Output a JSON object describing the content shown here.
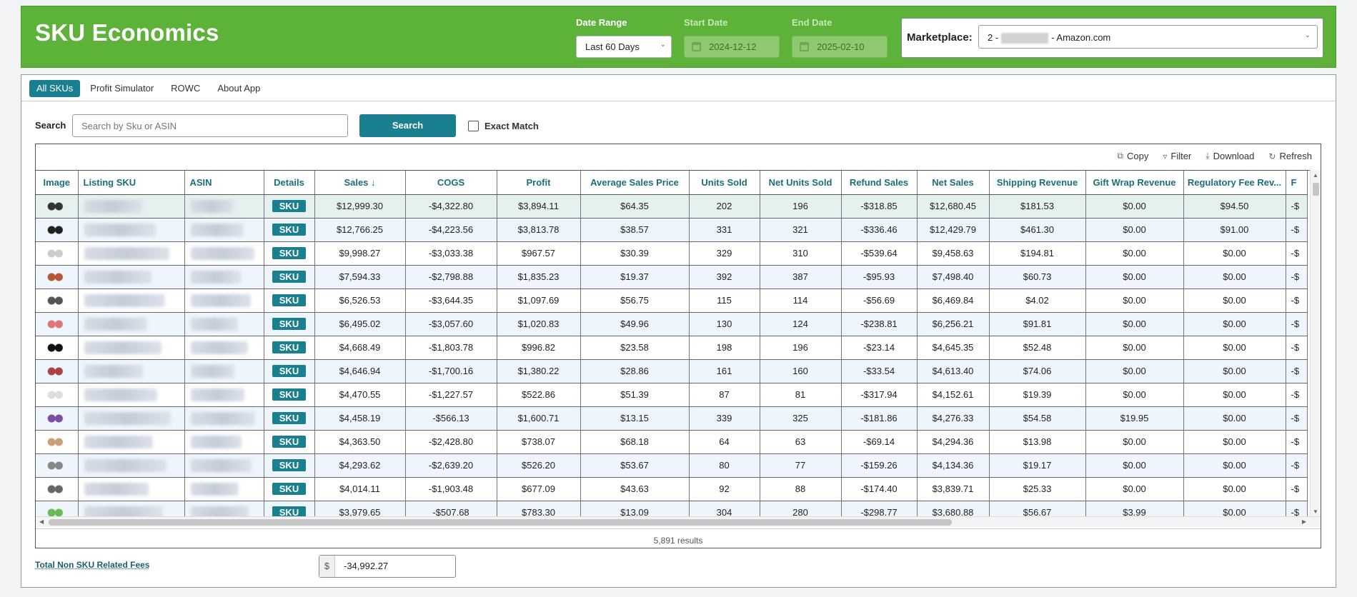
{
  "header": {
    "title": "SKU Economics",
    "date_range_label": "Date Range",
    "date_range_value": "Last 60 Days",
    "start_date_label": "Start Date",
    "start_date_value": "2024-12-12",
    "end_date_label": "End Date",
    "end_date_value": "2025-02-10",
    "marketplace_label": "Marketplace:",
    "marketplace_prefix": "2 -",
    "marketplace_suffix": "- Amazon.com",
    "brand_color": "#5db23a"
  },
  "tabs": [
    {
      "label": "All SKUs",
      "active": true
    },
    {
      "label": "Profit Simulator",
      "active": false
    },
    {
      "label": "ROWC",
      "active": false
    },
    {
      "label": "About App",
      "active": false
    }
  ],
  "search": {
    "label": "Search",
    "placeholder": "Search by Sku or ASIN",
    "button_label": "Search",
    "exact_match_label": "Exact Match",
    "exact_match_checked": false
  },
  "toolbar": {
    "copy": "Copy",
    "filter": "Filter",
    "download": "Download",
    "refresh": "Refresh"
  },
  "table": {
    "columns": [
      "Image",
      "Listing SKU",
      "ASIN",
      "Details",
      "Sales",
      "COGS",
      "Profit",
      "Average Sales Price",
      "Units Sold",
      "Net Units Sold",
      "Refund Sales",
      "Net Sales",
      "Shipping Revenue",
      "Gift Wrap Revenue",
      "Regulatory Fee Rev...",
      "F"
    ],
    "sort_indicator": "↓",
    "sku_badge": "SKU",
    "rows": [
      [
        "$12,999.30",
        "-$4,322.80",
        "$3,894.11",
        "$64.35",
        "202",
        "196",
        "-$318.85",
        "$12,680.45",
        "$181.53",
        "$0.00",
        "$94.50",
        "-$"
      ],
      [
        "$12,766.25",
        "-$4,223.56",
        "$3,813.78",
        "$38.57",
        "331",
        "321",
        "-$336.46",
        "$12,429.79",
        "$461.30",
        "$0.00",
        "$91.00",
        "-$"
      ],
      [
        "$9,998.27",
        "-$3,033.38",
        "$967.57",
        "$30.39",
        "329",
        "310",
        "-$539.64",
        "$9,458.63",
        "$194.81",
        "$0.00",
        "$0.00",
        "-$"
      ],
      [
        "$7,594.33",
        "-$2,798.88",
        "$1,835.23",
        "$19.37",
        "392",
        "387",
        "-$95.93",
        "$7,498.40",
        "$60.73",
        "$0.00",
        "$0.00",
        "-$"
      ],
      [
        "$6,526.53",
        "-$3,644.35",
        "$1,097.69",
        "$56.75",
        "115",
        "114",
        "-$56.69",
        "$6,469.84",
        "$4.02",
        "$0.00",
        "$0.00",
        "-$"
      ],
      [
        "$6,495.02",
        "-$3,057.60",
        "$1,020.83",
        "$49.96",
        "130",
        "124",
        "-$238.81",
        "$6,256.21",
        "$91.81",
        "$0.00",
        "$0.00",
        "-$"
      ],
      [
        "$4,668.49",
        "-$1,803.78",
        "$996.82",
        "$23.58",
        "198",
        "196",
        "-$23.14",
        "$4,645.35",
        "$52.48",
        "$0.00",
        "$0.00",
        "-$"
      ],
      [
        "$4,646.94",
        "-$1,700.16",
        "$1,380.22",
        "$28.86",
        "161",
        "160",
        "-$33.54",
        "$4,613.40",
        "$74.06",
        "$0.00",
        "$0.00",
        "-$"
      ],
      [
        "$4,470.55",
        "-$1,227.57",
        "$522.86",
        "$51.39",
        "87",
        "81",
        "-$317.94",
        "$4,152.61",
        "$19.39",
        "$0.00",
        "$0.00",
        "-$"
      ],
      [
        "$4,458.19",
        "-$566.13",
        "$1,600.71",
        "$13.15",
        "339",
        "325",
        "-$181.86",
        "$4,276.33",
        "$54.58",
        "$19.95",
        "$0.00",
        "-$"
      ],
      [
        "$4,363.50",
        "-$2,428.80",
        "$738.07",
        "$68.18",
        "64",
        "63",
        "-$69.14",
        "$4,294.36",
        "$13.98",
        "$0.00",
        "$0.00",
        "-$"
      ],
      [
        "$4,293.62",
        "-$2,639.20",
        "$526.20",
        "$53.67",
        "80",
        "77",
        "-$159.26",
        "$4,134.36",
        "$19.17",
        "$0.00",
        "$0.00",
        "-$"
      ],
      [
        "$4,014.11",
        "-$1,903.48",
        "$677.09",
        "$43.63",
        "92",
        "88",
        "-$174.40",
        "$3,839.71",
        "$25.33",
        "$0.00",
        "$0.00",
        "-$"
      ],
      [
        "$3,979.65",
        "-$507.68",
        "$783.30",
        "$13.09",
        "304",
        "280",
        "-$298.77",
        "$3,680.88",
        "$56.67",
        "$3.99",
        "$0.00",
        "-$"
      ]
    ],
    "results_text": "5,891 results",
    "accent_color": "#1a7f8e"
  },
  "fees": {
    "label": "Total Non SKU Related Fees",
    "prefix": "$",
    "value": "-34,992.27"
  }
}
